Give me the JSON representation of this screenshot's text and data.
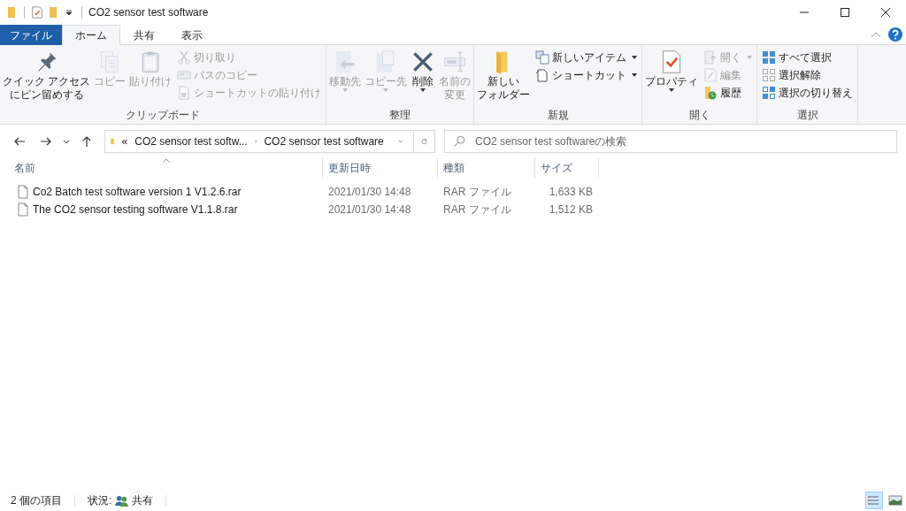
{
  "window": {
    "title": "CO2 sensor test software"
  },
  "tabs": [
    {
      "label": "ファイル",
      "kind": "file",
      "selected": false
    },
    {
      "label": "ホーム",
      "kind": "tab",
      "selected": true
    },
    {
      "label": "共有",
      "kind": "tab",
      "selected": false
    },
    {
      "label": "表示",
      "kind": "tab",
      "selected": false
    }
  ],
  "ribbon": [
    {
      "label": "クリップボード",
      "items": [
        {
          "kind": "large",
          "lines": [
            "クイック アクセス",
            "にピン留めする"
          ],
          "disabled": false,
          "menu": false
        },
        {
          "kind": "large",
          "lines": [
            "コピー"
          ],
          "disabled": true,
          "menu": false
        },
        {
          "kind": "large",
          "lines": [
            "貼り付け"
          ],
          "disabled": true,
          "menu": false
        },
        {
          "kind": "stack",
          "items": [
            {
              "label": "切り取り",
              "disabled": true,
              "menu": false
            },
            {
              "label": "パスのコピー",
              "disabled": true,
              "menu": false
            },
            {
              "label": "ショートカットの貼り付け",
              "disabled": true,
              "menu": false
            }
          ]
        }
      ]
    },
    {
      "label": "整理",
      "items": [
        {
          "kind": "large",
          "lines": [
            "移動先"
          ],
          "disabled": true,
          "menu": true
        },
        {
          "kind": "large",
          "lines": [
            "コピー先"
          ],
          "disabled": true,
          "menu": true
        },
        {
          "kind": "large",
          "lines": [
            "削除"
          ],
          "disabled": false,
          "menu": true
        },
        {
          "kind": "large",
          "lines": [
            "名前の",
            "変更"
          ],
          "disabled": true,
          "menu": false
        }
      ]
    },
    {
      "label": "新規",
      "items": [
        {
          "kind": "large",
          "lines": [
            "新しい",
            "フォルダー"
          ],
          "disabled": false,
          "menu": false
        },
        {
          "kind": "stack",
          "items": [
            {
              "label": "新しいアイテム",
              "disabled": false,
              "menu": true
            },
            {
              "label": "ショートカット",
              "disabled": false,
              "menu": true
            }
          ]
        }
      ]
    },
    {
      "label": "開く",
      "items": [
        {
          "kind": "large",
          "lines": [
            "プロパティ"
          ],
          "disabled": false,
          "menu": true
        },
        {
          "kind": "stack",
          "items": [
            {
              "label": "開く",
              "disabled": true,
              "menu": true
            },
            {
              "label": "編集",
              "disabled": true,
              "menu": false
            },
            {
              "label": "履歴",
              "disabled": false,
              "menu": false
            }
          ]
        }
      ]
    },
    {
      "label": "選択",
      "items": [
        {
          "kind": "stack",
          "items": [
            {
              "label": "すべて選択",
              "disabled": false,
              "menu": false
            },
            {
              "label": "選択解除",
              "disabled": false,
              "menu": false
            },
            {
              "label": "選択の切り替え",
              "disabled": false,
              "menu": false
            }
          ]
        }
      ]
    }
  ],
  "address": {
    "crumbs": [
      "«",
      "CO2 sensor test softw...",
      "CO2 sensor test software"
    ]
  },
  "search": {
    "placeholder": "CO2 sensor test softwareの検索"
  },
  "columns": [
    "名前",
    "更新日時",
    "種類",
    "サイズ"
  ],
  "files": [
    {
      "name": "Co2 Batch test software version 1  V1.2.6.rar",
      "modified": "2021/01/30 14:48",
      "type": "RAR ファイル",
      "size": "1,633 KB"
    },
    {
      "name": "The CO2 sensor testing software V1.1.8.rar",
      "modified": "2021/01/30 14:48",
      "type": "RAR ファイル",
      "size": "1,512 KB"
    }
  ],
  "status": {
    "count": "2 個の項目",
    "state_label": "状況:",
    "state": "共有"
  },
  "views": [
    {
      "kind": "details",
      "selected": true
    },
    {
      "kind": "tiles",
      "selected": false
    }
  ]
}
